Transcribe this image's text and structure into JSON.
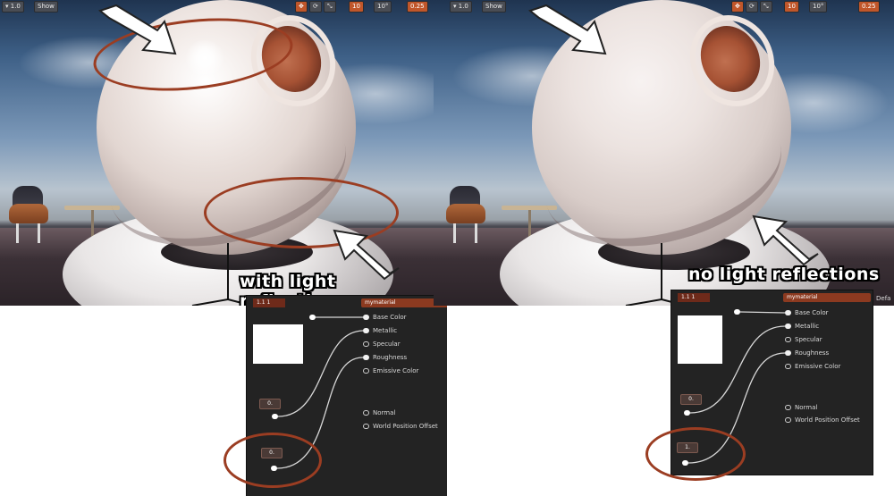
{
  "panels": [
    {
      "id": "with",
      "label": "with light reflections",
      "toolbar": {
        "show_label": "Show",
        "fov": "1.0",
        "angle": "10°",
        "grid": "10",
        "scale": "0.25"
      },
      "material_name": "mymaterial",
      "node_head_label": "1.1 1",
      "const_a": "0.",
      "const_b": "0.",
      "highlighted_ellipses": 2
    },
    {
      "id": "without",
      "label": "no light reflections",
      "toolbar": {
        "show_label": "Show",
        "fov": "1.0",
        "angle": "10°",
        "grid": "10",
        "scale": "0.25"
      },
      "material_name": "mymaterial",
      "node_head_label": "1.1 1",
      "const_a": "0.",
      "const_b": "1.",
      "corner_text": "Defa",
      "highlighted_ellipses": 1
    }
  ],
  "material_inputs": [
    {
      "label": "Base Color",
      "connected": true
    },
    {
      "label": "Metallic",
      "connected": true
    },
    {
      "label": "Specular",
      "connected": false
    },
    {
      "label": "Roughness",
      "connected": true
    },
    {
      "label": "Emissive Color",
      "connected": false
    },
    {
      "label": "Normal",
      "connected": false
    },
    {
      "label": "World Position Offset",
      "connected": false
    }
  ],
  "colors": {
    "accent": "#9b3d22",
    "node_bg": "#232323",
    "header": "#8c3a20"
  }
}
